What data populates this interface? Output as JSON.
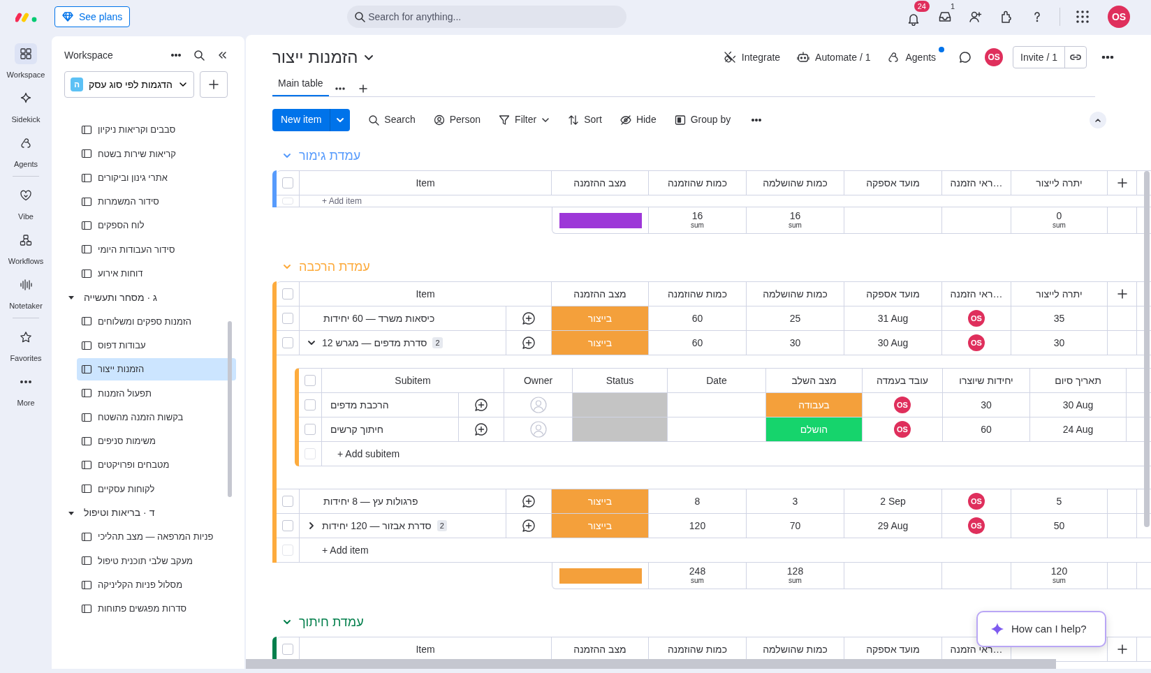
{
  "topbar": {
    "plans_button": "See plans",
    "search": {
      "placeholder": "Search for anything..."
    },
    "notification_count": "24",
    "inbox_count": "1",
    "avatar": "OS"
  },
  "rail": [
    {
      "label": "Workspace",
      "selected": true
    },
    {
      "label": "Sidekick",
      "selected": false
    },
    {
      "label": "Agents",
      "selected": false
    },
    {
      "label": "Vibe",
      "selected": false
    },
    {
      "label": "Workflows",
      "selected": false
    },
    {
      "label": "Notetaker",
      "selected": false
    },
    {
      "label": "Favorites",
      "selected": false
    },
    {
      "label": "More",
      "selected": false
    }
  ],
  "sidebar": {
    "title": "Workspace",
    "workspace": {
      "initial": "ה",
      "name": "הדגמות לפי סוג עסק"
    },
    "items": [
      {
        "kind": "board",
        "label": "סבבים וקריאות ניקיון",
        "selected": false
      },
      {
        "kind": "board",
        "label": "קריאות שירות בשטח",
        "selected": false
      },
      {
        "kind": "board",
        "label": "אתרי גינון וביקורים",
        "selected": false
      },
      {
        "kind": "board",
        "label": "סידור המשמרות",
        "selected": false
      },
      {
        "kind": "board",
        "label": "לוח הספקים",
        "selected": false
      },
      {
        "kind": "board",
        "label": "סידור העבודות היומי",
        "selected": false
      },
      {
        "kind": "board",
        "label": "דוחות אירוע",
        "selected": false
      },
      {
        "kind": "folder",
        "label": "ג · מסחר ותעשייה",
        "expanded": true,
        "children": [
          {
            "kind": "board",
            "label": "הזמנות ספקים ומשלוחים",
            "selected": false
          },
          {
            "kind": "board",
            "label": "עבודות דפוס",
            "selected": false
          },
          {
            "kind": "board",
            "label": "הזמנות ייצור",
            "selected": true
          },
          {
            "kind": "board",
            "label": "תפעול הזמנות",
            "selected": false
          },
          {
            "kind": "board",
            "label": "בקשות הזמנה מהשטח",
            "selected": false
          },
          {
            "kind": "board",
            "label": "משימות סניפים",
            "selected": false
          },
          {
            "kind": "board",
            "label": "מטבחים ופרויקטים",
            "selected": false
          },
          {
            "kind": "board",
            "label": "לקוחות עסקיים",
            "selected": false
          }
        ]
      },
      {
        "kind": "folder",
        "label": "ד · בריאות וטיפול",
        "expanded": true,
        "children": [
          {
            "kind": "board",
            "label": "פניות המרפאה — מצב תהליכי",
            "selected": false
          },
          {
            "kind": "board",
            "label": "מעקב שלבי תוכנית טיפול",
            "selected": false
          },
          {
            "kind": "board",
            "label": "מסלול פניות הקליניקה",
            "selected": false
          },
          {
            "kind": "board",
            "label": "סדרות מפגשים פתוחות",
            "selected": false
          }
        ]
      }
    ]
  },
  "board": {
    "title": "הזמנות ייצור",
    "actions": [
      {
        "kind": "agents",
        "label": "Agents",
        "unread": true
      },
      {
        "kind": "automate",
        "label": "Automate / 1",
        "unread": false
      },
      {
        "kind": "integrate",
        "label": "Integrate",
        "unread": false
      }
    ],
    "avatar": "OS",
    "invite": "Invite / 1",
    "views": [
      {
        "label": "Main table",
        "selected": true
      }
    ],
    "toolbar": {
      "new_item": "New item",
      "tools": [
        {
          "kind": "group",
          "label": "Group by"
        },
        {
          "kind": "hide",
          "label": "Hide"
        },
        {
          "kind": "sort",
          "label": "Sort"
        },
        {
          "kind": "filter",
          "label": "Filter"
        },
        {
          "kind": "person",
          "label": "Person"
        },
        {
          "kind": "search",
          "label": "Search"
        }
      ]
    }
  },
  "groups": [
    {
      "title": "עמדת גימור",
      "color": "#579bfc",
      "expanded": true,
      "checked": false,
      "columns": [
        "יתרה לייצור",
        "…ראי הזמנה",
        "מועד אספקה",
        "כמות שהושלמה",
        "כמות שהוזמנה",
        "מצב ההזמנה",
        "Item"
      ],
      "add_item": "+ Add item",
      "add_checkbox_disabled": true,
      "summary": [
        {
          "kind": "sum",
          "value": "0",
          "label": "sum"
        },
        {
          "kind": "empty"
        },
        {
          "kind": "empty"
        },
        {
          "kind": "sum",
          "value": "16",
          "label": "sum"
        },
        {
          "kind": "sum",
          "value": "16",
          "label": "sum"
        },
        {
          "kind": "bar",
          "color": "#9d37d8"
        }
      ]
    },
    {
      "title": "עמדת הרכבה",
      "color": "#fdab3d",
      "expanded": true,
      "checked": false,
      "columns": [
        "יתרה לייצור",
        "…ראי הזמנה",
        "מועד אספקה",
        "כמות שהושלמה",
        "כמות שהוזמנה",
        "מצב ההזמנה",
        "Item"
      ],
      "rows": [
        {
          "item": "כיסאות משרד — 60 יחידות",
          "checked": false,
          "status": {
            "label": "בייצור",
            "color": "#f4a03b"
          },
          "ordered": "60",
          "completed": "25",
          "delivery": "31 Aug",
          "owner": "OS",
          "surplus": "35"
        },
        {
          "item": "סדרת מדפים — מגרש 12",
          "checked": false,
          "subitem_count": "2",
          "expanded": true,
          "status": {
            "label": "בייצור",
            "color": "#f4a03b"
          },
          "ordered": "60",
          "completed": "30",
          "delivery": "30 Aug",
          "owner": "OS",
          "surplus": "30",
          "subitems": {
            "checked": false,
            "columns": [
              "תאריך סיום",
              "יחידות שיוצרו",
              "עובד בעמדה",
              "מצב השלב",
              "Date",
              "Status",
              "Owner",
              "Subitem"
            ],
            "rows": [
              {
                "name": "הרכבת מדפים",
                "checked": false,
                "status": {
                  "color": "#c4c4c4"
                },
                "stage": {
                  "label": "בעבודה",
                  "color": "#f4a03b"
                },
                "worker": "OS",
                "units": "30",
                "end_date": "30 Aug"
              },
              {
                "name": "חיתוך קרשים",
                "checked": false,
                "status": {
                  "color": "#c4c4c4"
                },
                "stage": {
                  "label": "הושלם",
                  "color": "#16d46c"
                },
                "worker": "OS",
                "units": "60",
                "end_date": "24 Aug"
              }
            ],
            "add": "+ Add subitem",
            "add_checkbox_disabled": true
          }
        },
        {
          "item": "פרגולות עץ — 8 יחידות",
          "checked": false,
          "status": {
            "label": "בייצור",
            "color": "#f4a03b"
          },
          "ordered": "8",
          "completed": "3",
          "delivery": "2 Sep",
          "owner": "OS",
          "surplus": "5"
        },
        {
          "item": "סדרת אבזור — 120 יחידות",
          "checked": false,
          "subitem_count": "2",
          "expanded": false,
          "status": {
            "label": "בייצור",
            "color": "#f4a03b"
          },
          "ordered": "120",
          "completed": "70",
          "delivery": "29 Aug",
          "owner": "OS",
          "surplus": "50"
        }
      ],
      "add_item": "+ Add item",
      "add_checkbox_disabled": true,
      "summary": [
        {
          "kind": "sum",
          "value": "120",
          "label": "sum"
        },
        {
          "kind": "empty"
        },
        {
          "kind": "empty"
        },
        {
          "kind": "sum",
          "value": "128",
          "label": "sum"
        },
        {
          "kind": "sum",
          "value": "248",
          "label": "sum"
        },
        {
          "kind": "bar",
          "color": "#f4a03b"
        }
      ]
    },
    {
      "title": "עמדת חיתוך",
      "color": "#037f4c",
      "expanded": true,
      "checked": false,
      "columns": [
        "…ראי הזמנה",
        "מועד אספקה",
        "כמות שהושלמה",
        "כמות שהוזמנה",
        "מצב ההזמנה",
        "Item"
      ]
    }
  ],
  "help_button": "How can I help?"
}
